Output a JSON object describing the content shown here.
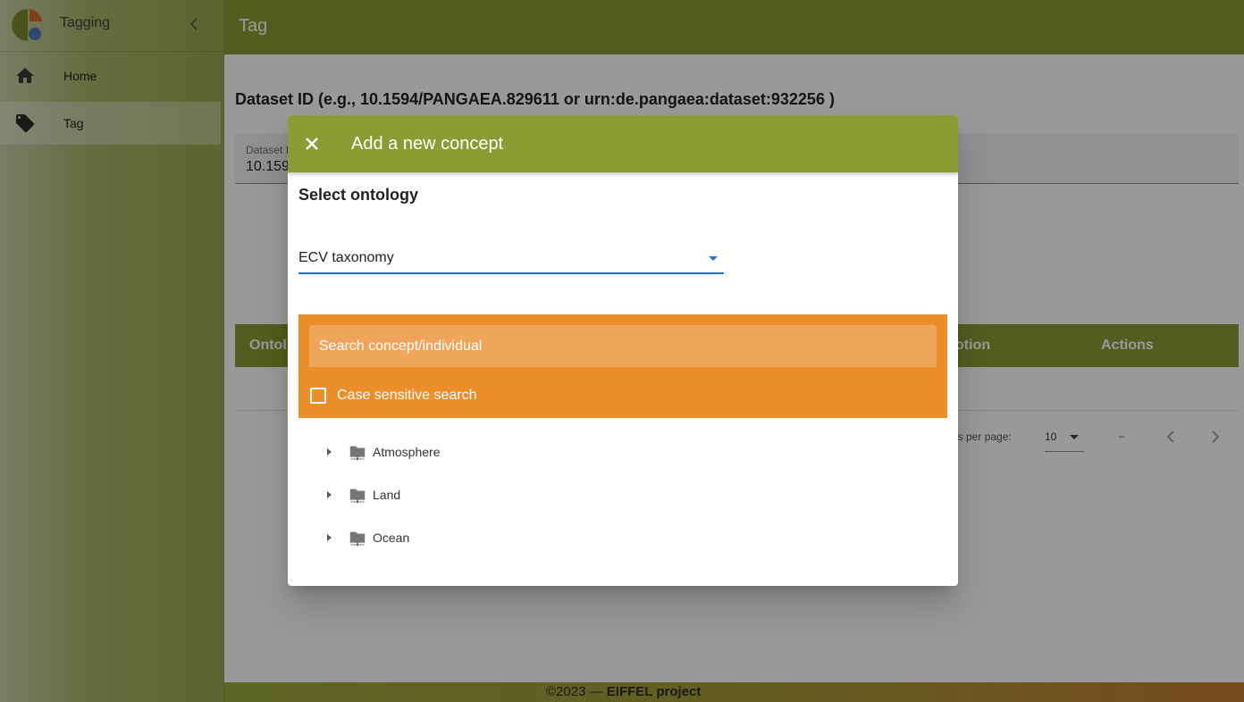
{
  "app": {
    "title": "Tagging"
  },
  "sidebar": {
    "items": [
      {
        "label": "Home",
        "icon": "home-icon",
        "active": false
      },
      {
        "label": "Tag",
        "icon": "tag-icon",
        "active": true
      }
    ]
  },
  "header": {
    "title": "Tag"
  },
  "main": {
    "dataset_label": "Dataset ID (e.g., 10.1594/PANGAEA.829611 or urn:de.pangaea:dataset:932256 )",
    "dataset_field_label": "Dataset I",
    "dataset_field_value": "10.159",
    "table_headers": [
      "Ontol",
      "otion",
      "Actions"
    ],
    "pagination": {
      "rows_label": "ws per page:",
      "rows_value": "10",
      "range": "–"
    }
  },
  "dialog": {
    "title": "Add a new concept",
    "subtitle": "Select ontology",
    "ontology_value": "ECV taxonomy",
    "search_placeholder": "Search concept/individual",
    "case_sensitive_label": "Case sensitive search",
    "tree": [
      {
        "label": "Atmosphere"
      },
      {
        "label": "Land"
      },
      {
        "label": "Ocean"
      }
    ]
  },
  "footer": {
    "copyright": "©2023 —",
    "project": "EIFFEL project"
  },
  "colors": {
    "accent": "#8b9c35",
    "search_panel": "#ec8f2a",
    "select_underline": "#1976d2"
  }
}
